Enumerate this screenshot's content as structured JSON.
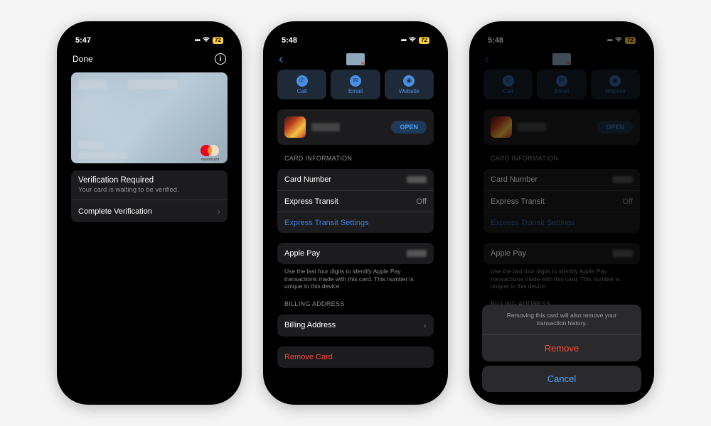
{
  "status": {
    "time1": "5:47",
    "time2": "5:48",
    "time3": "5:48",
    "battery": "72"
  },
  "screen1": {
    "nav_done": "Done",
    "verif_title": "Verification Required",
    "verif_sub": "Your card is waiting to be verified.",
    "complete": "Complete Verification"
  },
  "actions": {
    "call": "Call",
    "email": "Email",
    "website": "Website",
    "open": "OPEN"
  },
  "card_info": {
    "header": "Card Information",
    "number_label": "Card Number",
    "express_transit": "Express Transit",
    "express_transit_val": "Off",
    "express_settings": "Express Transit Settings"
  },
  "apple_pay": {
    "label": "Apple Pay",
    "note": "Use the last four digits to identify Apple Pay transactions made with this card. This number is unique to this device."
  },
  "billing": {
    "header": "Billing Address",
    "label": "Billing Address"
  },
  "remove_card": "Remove Card",
  "sheet": {
    "message": "Removing this card will also remove your transaction history.",
    "remove": "Remove",
    "cancel": "Cancel"
  }
}
